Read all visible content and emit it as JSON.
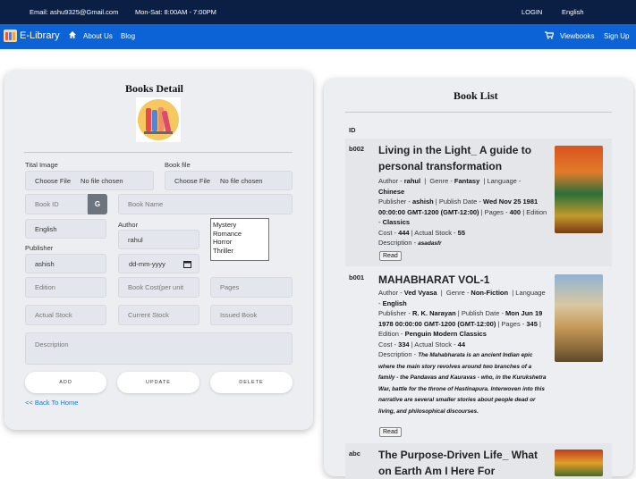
{
  "topbar": {
    "email": "Email: ashu9325@Gmail.com",
    "hours": "Mon-Sat: 8:00AM - 7:00PM",
    "login": "LOGIN",
    "language": "English"
  },
  "navbar": {
    "brand": "E-Library",
    "about": "About Us",
    "blog": "Blog",
    "viewbooks": "Viewbooks",
    "signup": "Sign Up"
  },
  "form": {
    "title": "Books Detail",
    "title_image_label": "Tital Image",
    "book_file_label": "Book file",
    "choose_file": "Choose File",
    "no_file": "No file chosen",
    "book_id_placeholder": "Book ID",
    "g_button": "G",
    "book_name_placeholder": "Book Name",
    "language_value": "English",
    "author_label": "Author",
    "author_value": "rahul",
    "genre_options": [
      "Mystery",
      "Romance",
      "Horror",
      "Thriller"
    ],
    "publisher_label": "Publisher",
    "publisher_value": "ashish",
    "date_placeholder": "dd-mm-yyyy",
    "edition_placeholder": "Edition",
    "cost_placeholder": "Book Cost(per unit",
    "pages_placeholder": "Pages",
    "actual_stock_placeholder": "Actual Stock",
    "current_stock_placeholder": "Current Stock",
    "issued_book_placeholder": "Issued Book",
    "description_placeholder": "Description",
    "add": "ADD",
    "update": "UPDATE",
    "delete": "DELETE",
    "back_link": "<< Back To Home"
  },
  "list": {
    "title": "Book List",
    "id_header": "ID",
    "read": "Read",
    "books": [
      {
        "id": "b002",
        "title": "Living in the Light_ A guide to personal transformation",
        "author": "rahul",
        "genre": "Fantasy",
        "language": "Chinese",
        "publisher": "ashish",
        "publish_date": "Wed Nov 25 1981 00:00:00 GMT-1200 (GMT-12:00)",
        "pages": "400",
        "edition": "Classics",
        "cost": "444",
        "actual_stock": "55",
        "description": "asadasfr"
      },
      {
        "id": "b001",
        "title": "MAHABHARAT VOL-1",
        "author": "Ved Vyasa",
        "genre": "Non-Fiction",
        "language": "English",
        "publisher": "R. K. Narayan",
        "publish_date": "Mon Jun 19 1978 00:00:00 GMT-1200 (GMT-12:00)",
        "pages": "345",
        "edition": "Penguin Modern Classics",
        "cost": "334",
        "actual_stock": "44",
        "description": "The Mahabharata is an ancient Indian epic where the main story revolves around two branches of a family - the Pandavas and Kauravas - who, in the Kurukshetra War, battle for the throne of Hastinapura. Interwoven into this narrative are several smaller stories about people dead or living, and philosophical discourses."
      },
      {
        "id": "abc",
        "title": "The Purpose-Driven Life_ What on Earth Am I Here For"
      }
    ]
  },
  "colors": {
    "topbar": "#0b1f44",
    "navbar": "#0b63d6",
    "link": "#1a73e8"
  }
}
